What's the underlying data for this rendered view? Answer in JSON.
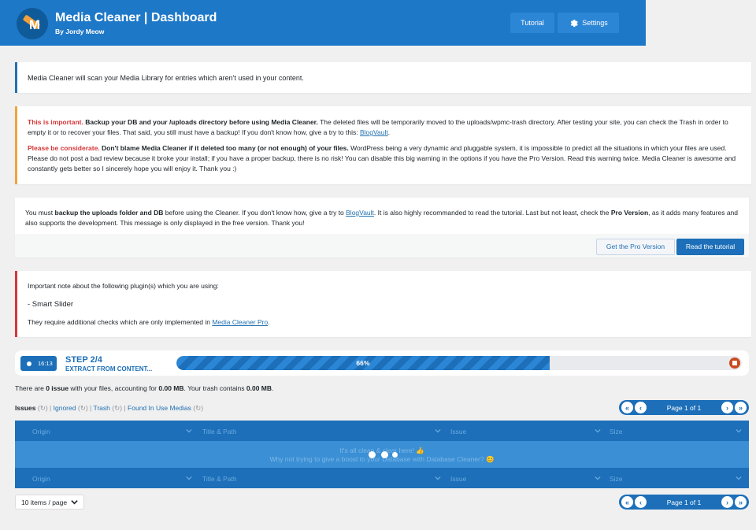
{
  "header": {
    "title": "Media Cleaner | Dashboard",
    "subtitle": "By Jordy Meow",
    "logo_letter": "M",
    "tutorial_label": "Tutorial",
    "settings_label": "Settings"
  },
  "notice_info": {
    "text": "Media Cleaner will scan your Media Library for entries which aren't used in your content."
  },
  "notice_warning": {
    "p1_important": "This is important.",
    "p1_bold": " Backup your DB and your /uploads directory before using Media Cleaner.",
    "p1_text": " The deleted files will be temporarily moved to the uploads/wpmc-trash directory. After testing your site, you can check the Trash in order to empty it or to recover your files. That said, you still must have a backup! If you don't know how, give a try to this: ",
    "p1_link": "BlogVault",
    "p1_end": ".",
    "p2_considerate": "Please be considerate.",
    "p2_bold": " Don't blame Media Cleaner if it deleted too many (or not enough) of your files.",
    "p2_text": " WordPress being a very dynamic and pluggable system, it is impossible to predict all the situations in which your files are used. Please do not post a bad review because it broke your install; if you have a proper backup, there is no risk! You can disable this big warning in the options if you have the Pro Version. Read this warning twice. Media Cleaner is awesome and constantly gets better so I sincerely hope you will enjoy it. Thank you :)"
  },
  "notice_backup": {
    "t1": "You must ",
    "t1_bold": "backup the uploads folder and DB",
    "t2": " before using the Cleaner. If you don't know how, give a try to ",
    "link": "BlogVault",
    "t3": ". It is also highly recommanded to read the tutorial. Last but not least, check the ",
    "t3_bold": "Pro Version",
    "t4": ", as it adds many features and also supports the development. This message is only displayed in the free version. Thank you!",
    "btn_pro": "Get the Pro Version",
    "btn_tutorial": "Read the tutorial"
  },
  "notice_plugins": {
    "intro": "Important note about the following plugin(s) which you are using:",
    "plugin": "- Smart Slider",
    "t1": "They require additional checks which are only implemented in ",
    "link": "Media Cleaner Pro",
    "t2": "."
  },
  "progress": {
    "time": "16:13",
    "step": "STEP 2/4",
    "step_label": "EXTRACT FROM CONTENT...",
    "percent_label": "66%",
    "percent": 66
  },
  "summary": {
    "t1": "There are ",
    "issues": "0 issue",
    "t2": " with your files, accounting for ",
    "size": "0.00 MB",
    "t3": ". Your trash contains ",
    "trash": "0.00 MB",
    "t4": "."
  },
  "filters": {
    "issues": "Issues",
    "ignored": "Ignored",
    "trash": "Trash",
    "found": "Found In Use Medias",
    "count": "(",
    "count_end": ")",
    "sep": "|"
  },
  "pager": {
    "text": "Page 1 of 1",
    "first": "«",
    "prev": "‹",
    "next": "›",
    "last": "»"
  },
  "table": {
    "columns": [
      "Origin",
      "Title & Path",
      "Issue",
      "Size"
    ],
    "empty_line1": "It's all clean & clear here! 👍",
    "empty_line2": "Why not trying to give a boost to your Database with Database Cleaner? 😊"
  },
  "per_page": "10 items / page",
  "colors": {
    "brand": "#1e78c8",
    "button": "#1c6fb8",
    "warning_border": "#f0a43b",
    "error_border": "#d63638",
    "important_red": "#d63638"
  }
}
